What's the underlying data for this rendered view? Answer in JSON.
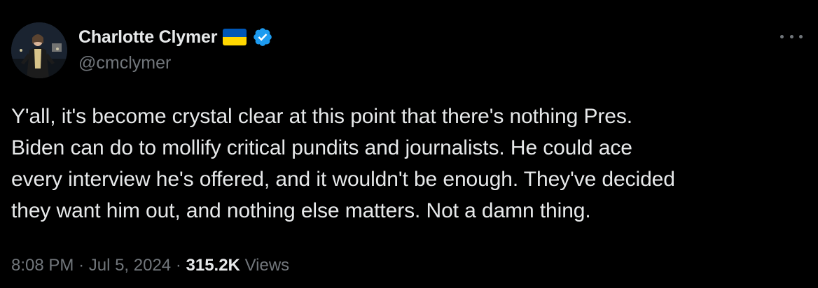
{
  "author": {
    "display_name": "Charlotte Clymer",
    "handle": "@cmclymer",
    "flag_icon": "ukraine-flag",
    "verified_icon": "verified-badge",
    "colors": {
      "flag_top": "#0057b7",
      "flag_bottom": "#ffd700",
      "verified": "#1d9bf0"
    }
  },
  "tweet": {
    "text_lines": [
      "Y'all, it's become crystal clear at this point that there's nothing Pres.",
      "Biden can do to mollify critical pundits and journalists. He could ace",
      "every interview he's offered, and it wouldn't be enough. They've decided",
      "they want him out, and nothing else matters. Not a damn thing."
    ]
  },
  "meta": {
    "time": "8:08 PM",
    "separator": "·",
    "date": "Jul 5, 2024",
    "views_count": "315.2K",
    "views_label": "Views"
  },
  "menu": {
    "icon": "more-options-icon"
  }
}
